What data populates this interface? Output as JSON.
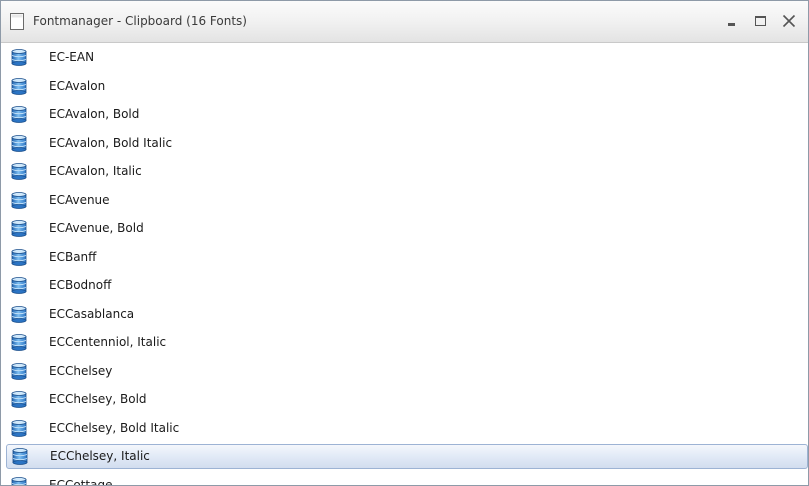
{
  "window": {
    "title": "Fontmanager - Clipboard (16 Fonts)"
  },
  "icons": {
    "title": "document-icon",
    "font_item": "font-database-icon",
    "minimize": "minimize-icon",
    "maximize": "maximize-icon",
    "close": "close-icon"
  },
  "colors": {
    "selection_border": "#9db3d4",
    "selection_fill": "#dfe8f6",
    "icon_blue": "#3a86d2"
  },
  "fonts": [
    {
      "label": "EC-EAN",
      "selected": false
    },
    {
      "label": "ECAvalon",
      "selected": false
    },
    {
      "label": "ECAvalon, Bold",
      "selected": false
    },
    {
      "label": "ECAvalon, Bold Italic",
      "selected": false
    },
    {
      "label": "ECAvalon, Italic",
      "selected": false
    },
    {
      "label": "ECAvenue",
      "selected": false
    },
    {
      "label": "ECAvenue, Bold",
      "selected": false
    },
    {
      "label": "ECBanff",
      "selected": false
    },
    {
      "label": "ECBodnoff",
      "selected": false
    },
    {
      "label": "ECCasablanca",
      "selected": false
    },
    {
      "label": "ECCentenniol, Italic",
      "selected": false
    },
    {
      "label": "ECChelsey",
      "selected": false
    },
    {
      "label": "ECChelsey, Bold",
      "selected": false
    },
    {
      "label": "ECChelsey, Bold Italic",
      "selected": false
    },
    {
      "label": "ECChelsey, Italic",
      "selected": true
    },
    {
      "label": "ECCottage",
      "selected": false
    }
  ]
}
